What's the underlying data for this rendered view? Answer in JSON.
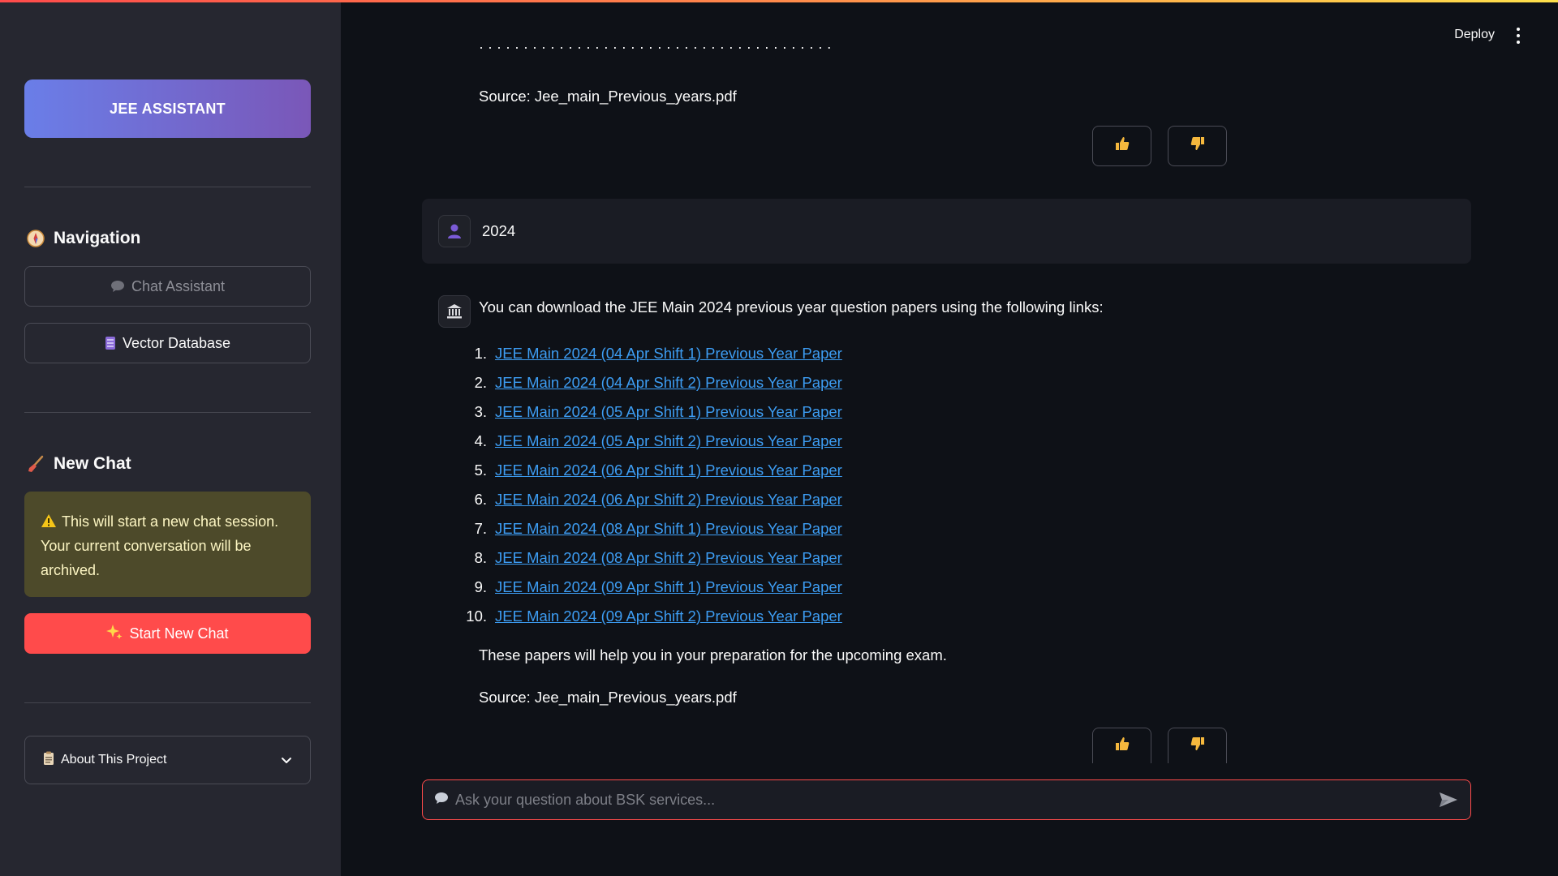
{
  "sidebar": {
    "brand": "JEE ASSISTANT",
    "navigation_title": "Navigation",
    "nav_items": [
      {
        "label": "Chat Assistant",
        "icon": "speech-bubble-icon",
        "state": "disabled"
      },
      {
        "label": "Vector Database",
        "icon": "database-icon",
        "state": "active"
      }
    ],
    "new_chat_title": "New Chat",
    "warning_text": "This will start a new chat session. Your current conversation will be archived.",
    "start_button": "Start New Chat",
    "about_label": "About This Project"
  },
  "header": {
    "deploy": "Deploy"
  },
  "messages": {
    "previous_source": "Source: Jee_main_Previous_years.pdf",
    "user_message": "2024",
    "bot_intro": "You can download the JEE Main 2024 previous year question papers using the following links:",
    "links": [
      "JEE Main 2024 (04 Apr Shift 1) Previous Year Paper",
      "JEE Main 2024 (04 Apr Shift 2) Previous Year Paper",
      "JEE Main 2024 (05 Apr Shift 1) Previous Year Paper",
      "JEE Main 2024 (05 Apr Shift 2) Previous Year Paper",
      "JEE Main 2024 (06 Apr Shift 1) Previous Year Paper",
      "JEE Main 2024 (06 Apr Shift 2) Previous Year Paper",
      "JEE Main 2024 (08 Apr Shift 1) Previous Year Paper",
      "JEE Main 2024 (08 Apr Shift 2) Previous Year Paper",
      "JEE Main 2024 (09 Apr Shift 1) Previous Year Paper",
      "JEE Main 2024 (09 Apr Shift 2) Previous Year Paper"
    ],
    "closing": "These papers will help you in your preparation for the upcoming exam.",
    "source": "Source: Jee_main_Previous_years.pdf"
  },
  "chat_input": {
    "placeholder": "Ask your question about BSK services..."
  },
  "colors": {
    "accent": "#ff4b4b",
    "link": "#3d9df3",
    "sidebar_bg": "#262730",
    "main_bg": "#0e1117"
  }
}
